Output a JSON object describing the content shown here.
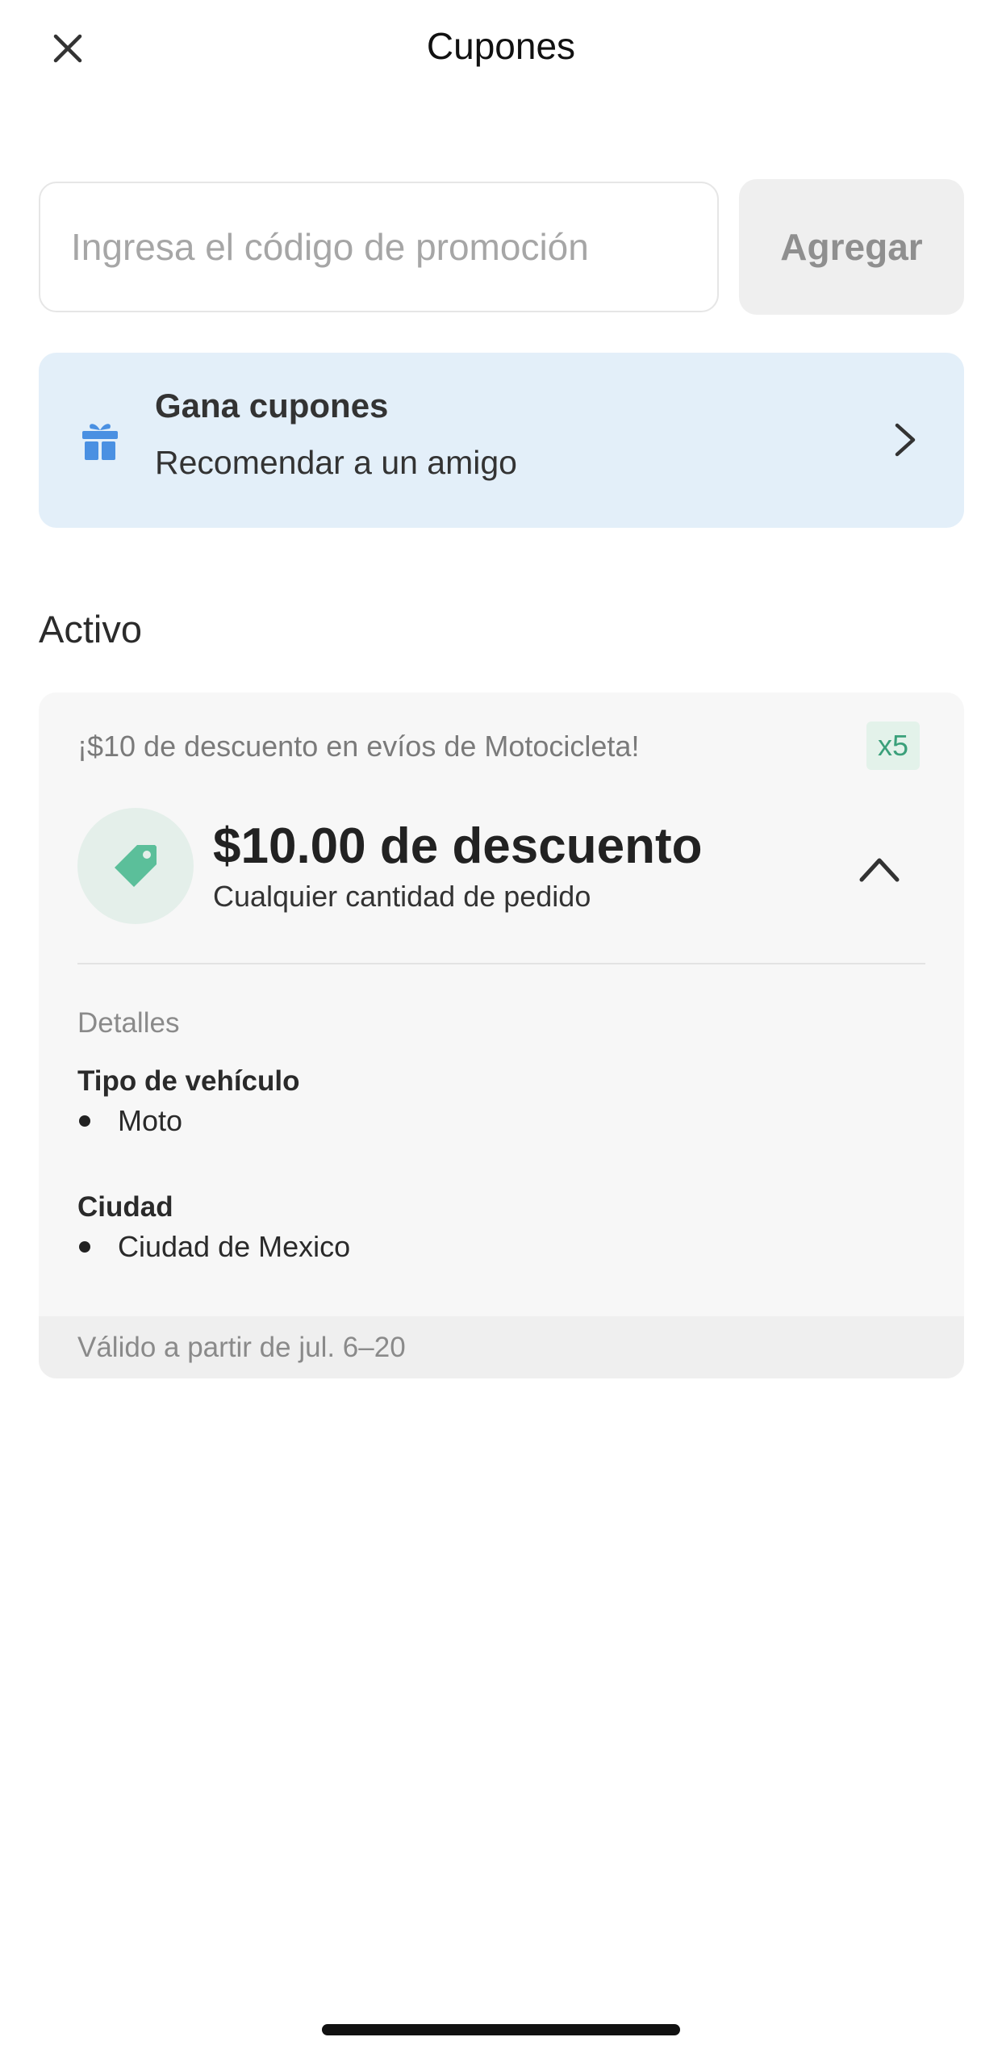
{
  "header": {
    "title": "Cupones",
    "close_icon": "close-icon"
  },
  "promo": {
    "placeholder": "Ingresa el código de promoción",
    "value": "",
    "add_label": "Agregar"
  },
  "referral": {
    "icon": "gift-icon",
    "title": "Gana cupones",
    "subtitle": "Recomendar a un amigo",
    "chevron_icon": "chevron-right-icon",
    "bg_color": "#e3eff9",
    "icon_color": "#4a90e2"
  },
  "section": {
    "title": "Activo"
  },
  "coupon": {
    "headline": "¡$10 de descuento en evíos de Motocicleta!",
    "count": "x5",
    "icon": "tag-icon",
    "amount": "$10.00 de descuento",
    "condition": "Cualquier cantidad de pedido",
    "collapse_icon": "chevron-up-icon",
    "details_label": "Detalles",
    "vehicle_title": "Tipo de vehículo",
    "vehicle_items": [
      "Moto"
    ],
    "city_title": "Ciudad",
    "city_items": [
      "Ciudad de Mexico"
    ],
    "validity": "Válido a partir de jul. 6–20",
    "accent_color": "#5bbf9a"
  }
}
